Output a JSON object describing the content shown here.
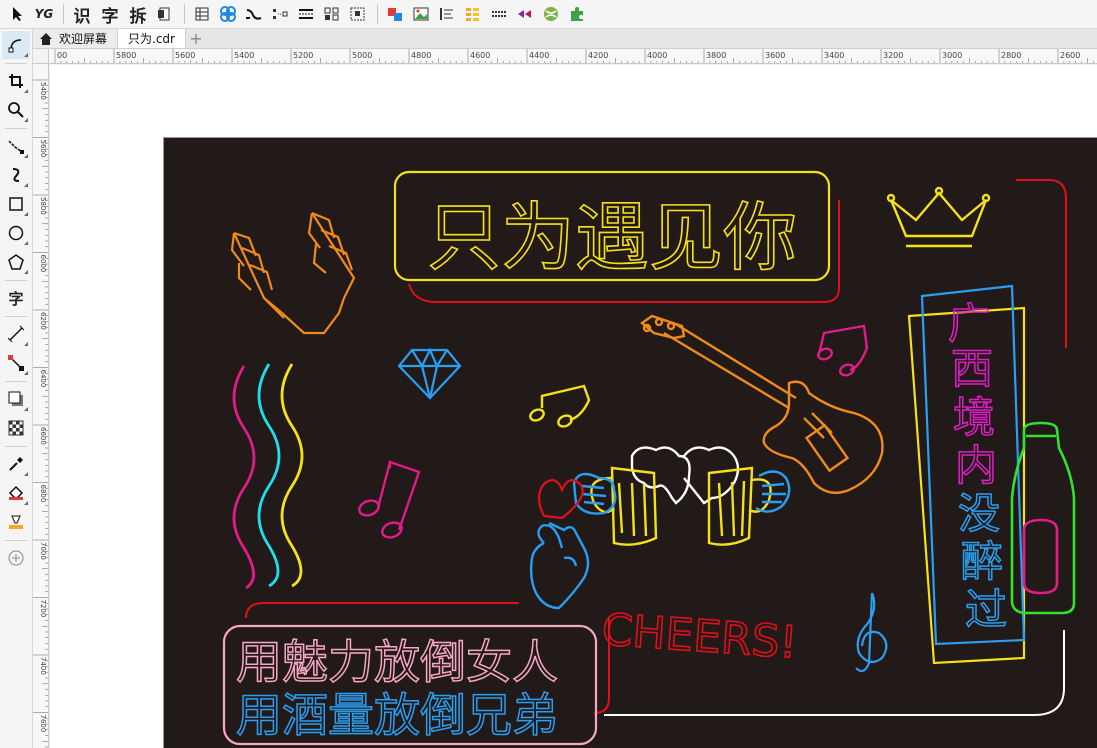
{
  "toolbar": {
    "text_tools": [
      "识",
      "字",
      "拆"
    ]
  },
  "tabs": {
    "welcome": "欢迎屏幕",
    "document": "只为.cdr"
  },
  "rulers": {
    "horizontal": [
      "00",
      "5800",
      "5600",
      "5400",
      "5200",
      "5000",
      "4800",
      "4600",
      "4400",
      "4200",
      "4000",
      "3800",
      "3600",
      "3400",
      "3200",
      "3000",
      "2800",
      "2600"
    ],
    "vertical": [
      "5400",
      "5600",
      "5800",
      "6000",
      "6200",
      "6400",
      "6600",
      "6800",
      "7000",
      "7200",
      "7400",
      "7600"
    ]
  },
  "toolbox": {
    "text_tool": "字"
  },
  "artwork": {
    "title": "只为遇见你",
    "vertical_text": [
      "广",
      "西",
      "境",
      "内",
      "没",
      "醉",
      "过"
    ],
    "line1": "用魅力放倒女人",
    "line2": "用酒量放倒兄弟",
    "cheers": "CHEERS!"
  }
}
